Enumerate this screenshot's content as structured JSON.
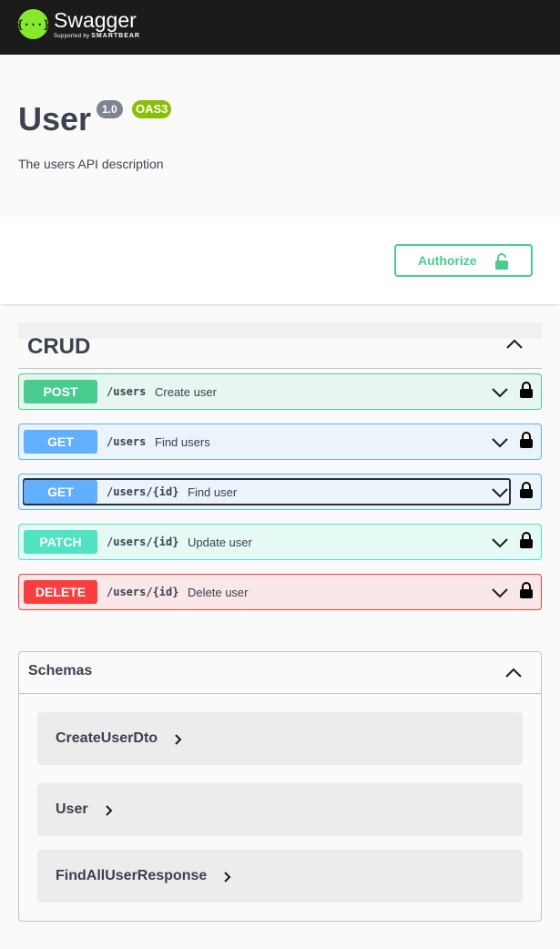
{
  "topbar": {
    "brand": "Swagger",
    "sub_prefix": "Supported by",
    "sub_brand": "SMARTBEAR",
    "logo_glyph": "{···}"
  },
  "info": {
    "title": "User",
    "version": "1.0",
    "oas": "OAS3",
    "description": "The users API description"
  },
  "scheme": {
    "authorize_label": "Authorize"
  },
  "tag": {
    "name": "CRUD"
  },
  "operations": [
    {
      "method": "POST",
      "path": "/users",
      "summary": "Create user"
    },
    {
      "method": "GET",
      "path": "/users",
      "summary": "Find users"
    },
    {
      "method": "GET",
      "path": "/users/{id}",
      "summary": "Find user"
    },
    {
      "method": "PATCH",
      "path": "/users/{id}",
      "summary": "Update user"
    },
    {
      "method": "DELETE",
      "path": "/users/{id}",
      "summary": "Delete user"
    }
  ],
  "schemas": {
    "title": "Schemas",
    "models": [
      {
        "name": "CreateUserDto"
      },
      {
        "name": "User"
      },
      {
        "name": "FindAllUserResponse"
      }
    ]
  },
  "colors": {
    "post": "#49cc90",
    "get": "#61affe",
    "patch": "#50e3c2",
    "delete": "#f93e3e",
    "post_bg": "#e8f6f0",
    "get_bg": "#ebf3fb",
    "patch_bg": "#e5f9f5",
    "delete_bg": "#fae7e7",
    "accent": "#85ea2d"
  }
}
